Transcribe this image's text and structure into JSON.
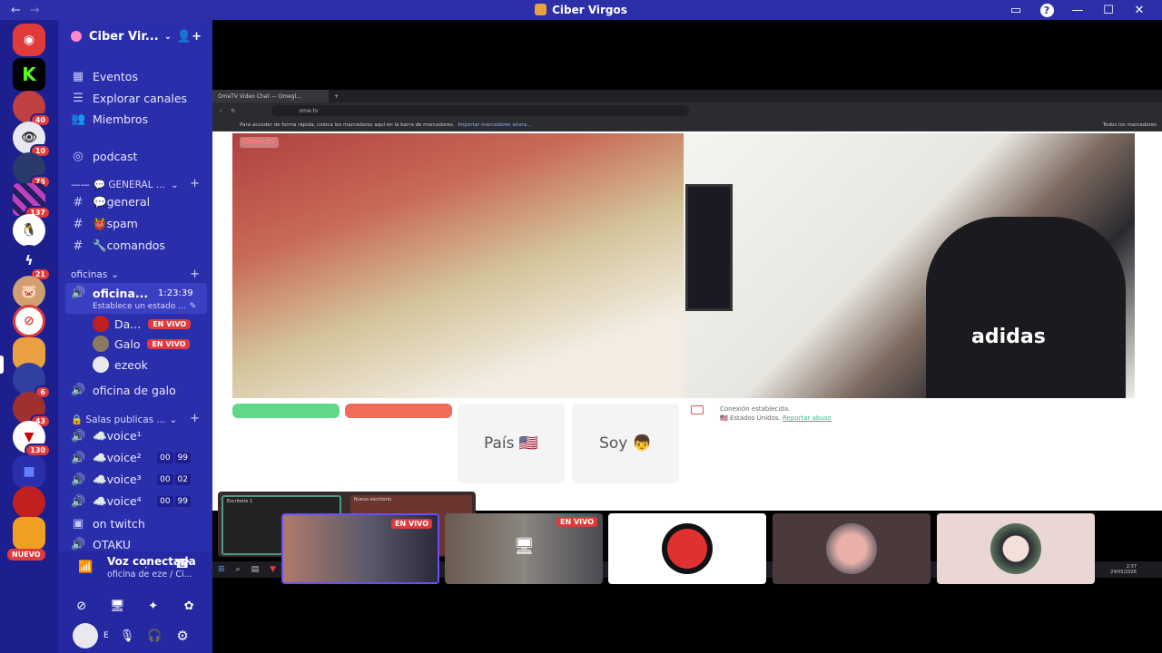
{
  "titlebar": {
    "title": "Ciber Virgos",
    "back": "←",
    "forward": "→",
    "help": "?"
  },
  "rail": {
    "servers": [
      {
        "name": "discord-home",
        "badge": ""
      },
      {
        "name": "server-k",
        "badge": ""
      },
      {
        "name": "server-2",
        "badge": "40"
      },
      {
        "name": "server-3",
        "badge": "10"
      },
      {
        "name": "server-4",
        "badge": "75"
      },
      {
        "name": "server-5",
        "badge": "137"
      },
      {
        "name": "server-6",
        "badge": ""
      },
      {
        "name": "server-7",
        "badge": "21"
      },
      {
        "name": "server-8",
        "badge": ""
      },
      {
        "name": "server-9",
        "badge": ""
      },
      {
        "name": "ciber-virgos",
        "badge": ""
      },
      {
        "name": "server-11",
        "badge": "6"
      },
      {
        "name": "server-12",
        "badge": "43"
      },
      {
        "name": "server-13",
        "badge": "130"
      },
      {
        "name": "folder",
        "badge": ""
      },
      {
        "name": "server-15",
        "badge": ""
      }
    ],
    "nuevo": "NUEVO"
  },
  "sidebar": {
    "guild_name": "Ciber Vir...",
    "top": {
      "events": "Eventos",
      "explore": "Explorar canales",
      "members": "Miembros",
      "podcast": "podcast"
    },
    "general_cat": "💬 GENERAL ...",
    "channels": [
      {
        "label": "💬general"
      },
      {
        "label": "👹spam"
      },
      {
        "label": "🔧comandos"
      }
    ],
    "oficinas_cat": "oficinas",
    "active_voice": {
      "label": "oficina...",
      "time": "1:23:39",
      "status": "Establece un estado ..."
    },
    "voice_users": [
      {
        "name": "Da...",
        "live": "EN VIVO"
      },
      {
        "name": "Galo",
        "live": "EN VIVO"
      },
      {
        "name": "ezeok",
        "live": ""
      }
    ],
    "oficina_galo": "oficina de galo",
    "salas_cat": "🔒 Salas publicas ...",
    "voices": [
      {
        "label": "☁️voice¹",
        "count": ""
      },
      {
        "label": "☁️voice²",
        "count": [
          "00",
          "99"
        ]
      },
      {
        "label": "☁️voice³",
        "count": [
          "00",
          "02"
        ]
      },
      {
        "label": "☁️voice⁴",
        "count": [
          "00",
          "99"
        ]
      },
      {
        "label": "on twitch",
        "count": ""
      },
      {
        "label": "OTAKU",
        "count": ""
      }
    ],
    "voice_panel": {
      "title": "Voz conectada",
      "sub": "oficina de eze / Ci..."
    },
    "user": {
      "name": "E",
      "status": "Ei"
    }
  },
  "browser": {
    "tab": "OmeTV Video Chat — Omegl...",
    "url": "ome.tv",
    "bookmarks": "Para acceder de forma rápida, coloca los marcadores aquí en la barra de marcadores.",
    "bookmarks_link": "Importar marcadores ahora...",
    "all_bookmarks": "Todos los marcadores",
    "logo": "Ome.tv",
    "btn_country": "País",
    "btn_country_flag": "🇺🇸",
    "btn_soy": "Soy",
    "btn_soy_emoji": "👦",
    "chat_line1": "Conexión establecida.",
    "chat_line2": "Estados Unidos.",
    "chat_link": "Reportar abuso",
    "desk1": "Escritorio 1",
    "desk2": "Nuevo escritorio",
    "desk_plus": "+",
    "overlay_text": "adidas",
    "clock": "2:37",
    "date": "24/05/2026"
  },
  "tiles": [
    {
      "live": "EN VIVO"
    },
    {
      "live": "EN VIVO"
    },
    {
      "live": ""
    },
    {
      "live": ""
    },
    {
      "live": ""
    }
  ]
}
